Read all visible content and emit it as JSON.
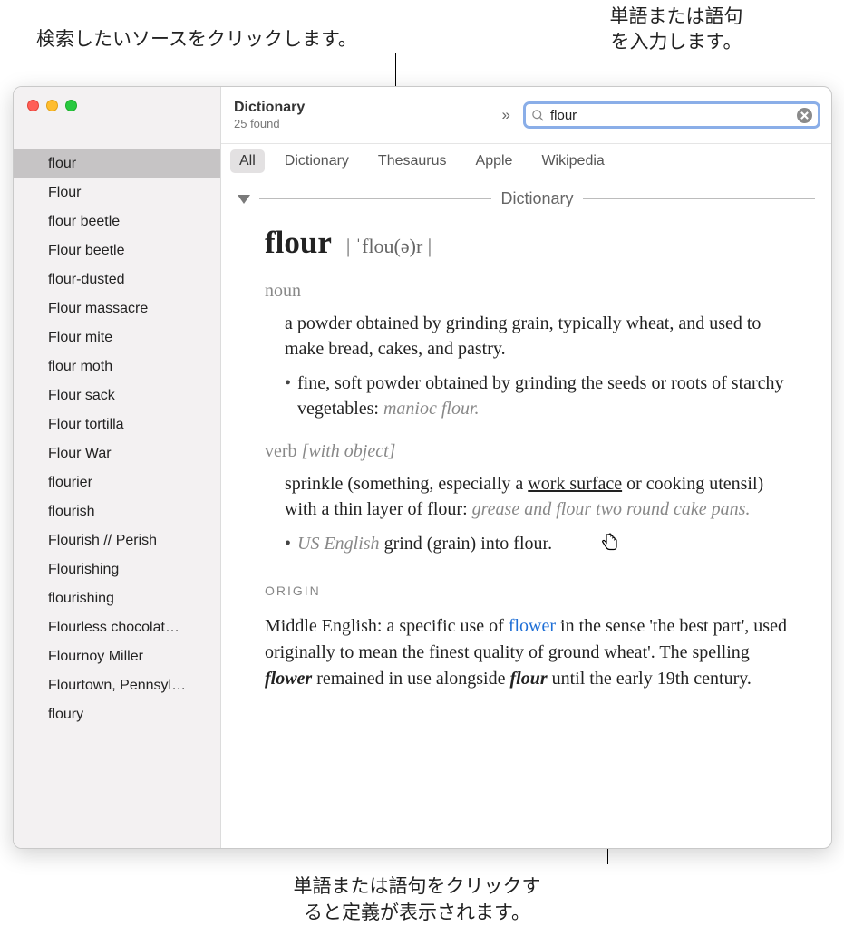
{
  "annotations": {
    "top_left": "検索したいソースをクリックします。",
    "top_right_l1": "単語または語句",
    "top_right_l2": "を入力します。",
    "bottom_l1": "単語または語句をクリックす",
    "bottom_l2": "ると定義が表示されます。"
  },
  "window": {
    "title": "Dictionary",
    "subtitle": "25 found"
  },
  "search": {
    "value": "flour"
  },
  "tabs": [
    "All",
    "Dictionary",
    "Thesaurus",
    "Apple",
    "Wikipedia"
  ],
  "section_title": "Dictionary",
  "sidebar": {
    "items": [
      "flour",
      "Flour",
      "flour beetle",
      "Flour beetle",
      "flour-dusted",
      "Flour massacre",
      "Flour mite",
      "flour moth",
      "Flour sack",
      "Flour tortilla",
      "Flour War",
      "flourier",
      "flourish",
      "Flourish // Perish",
      "Flourishing",
      "flourishing",
      "Flourless chocolat…",
      "Flournoy Miller",
      "Flourtown, Pennsyl…",
      "floury"
    ],
    "selected_index": 0
  },
  "entry": {
    "headword": "flour",
    "pronunciation": "| ˈflou(ə)r |",
    "noun": {
      "label": "noun",
      "def": "a powder obtained by grinding grain, typically wheat, and used to make bread, cakes, and pastry",
      "sub_def": "fine, soft powder obtained by grinding the seeds or roots of starchy vegetables",
      "sub_example": "manioc flour."
    },
    "verb": {
      "label": "verb",
      "qualifier": "[with object]",
      "def_pre": "sprinkle (something, especially a ",
      "hotlink": "work surface",
      "def_post": " or cooking utensil) with a thin layer of flour",
      "example": "grease and flour two round cake pans.",
      "sub_region": "US English",
      "sub_def": "grind (grain) into flour"
    },
    "origin": {
      "label": "ORIGIN",
      "pre": "Middle English: a specific use of ",
      "link": "flower",
      "mid1": " in the sense 'the best part', used originally to mean the finest quality of ground wheat'. The spelling ",
      "em1": "flower",
      "mid2": " remained in use alongside ",
      "em2": "flour",
      "post": " until the early 19th century."
    }
  }
}
